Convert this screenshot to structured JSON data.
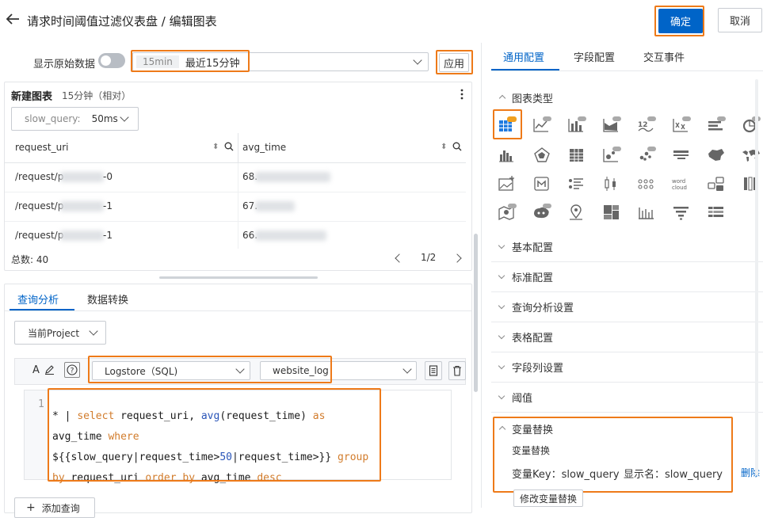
{
  "header": {
    "title": "请求时间阈值过滤仪表盘 / 编辑图表",
    "confirm_label": "确定",
    "cancel_label": "取消"
  },
  "toolbar": {
    "show_raw_label": "显示原始数据",
    "time_tag": "15min",
    "time_label": "最近15分钟",
    "apply_label": "应用"
  },
  "chart": {
    "title": "新建图表",
    "subtitle": "15分钟（相对）",
    "variable_name": "slow_query:",
    "variable_value": "50ms",
    "columns": [
      "request_uri",
      "avg_time"
    ],
    "rows": [
      {
        "uri": "/request/p",
        "uri_suffix": "-0",
        "avg": "68."
      },
      {
        "uri": "/request/p",
        "uri_suffix": "-1",
        "avg": "67."
      },
      {
        "uri": "/request/p",
        "uri_suffix": "-1",
        "avg": "66."
      }
    ],
    "total_label": "总数: 40",
    "page_label": "1/2"
  },
  "query": {
    "tabs": [
      "查询分析",
      "数据转换"
    ],
    "project_label": "当前Project",
    "logstore_type": "Logstore（SQL)",
    "logstore_name": "website_log",
    "line_number": "1",
    "code_line1_a": "* | ",
    "code_line1_b": "select",
    "code_line1_c": " request_uri, ",
    "code_line1_d": "avg",
    "code_line1_e": "(request_time) ",
    "code_line1_f": "as",
    "code_line2_a": "avg_time ",
    "code_line2_b": "where",
    "code_line3_a": "${{slow_query|request_time>",
    "code_line3_b": "50",
    "code_line3_c": "|request_time>}} ",
    "code_line3_d": "group",
    "code_line4_a": "by",
    "code_line4_b": " request_uri ",
    "code_line4_c": "order by",
    "code_line4_d": " avg_time ",
    "code_line4_e": "desc",
    "add_query_label": "添加查询"
  },
  "right_panel": {
    "tabs": [
      "通用配置",
      "字段配置",
      "交互事件"
    ],
    "chart_type_label": "图表类型",
    "sections": [
      "基本配置",
      "标准配置",
      "查询分析设置",
      "表格配置",
      "字段列设置",
      "阈值"
    ],
    "var_section_label": "变量替换",
    "var_sub_label": "变量替换",
    "var_key_label": "变量Key：slow_query",
    "var_display_label": "显示名：slow_query",
    "delete_label": "删除",
    "modify_label": "修改变量替换"
  },
  "colors": {
    "accent": "#0064c8",
    "highlight": "#ee7a19",
    "keyword": "#d27c2c",
    "pro_badge": "#f0a020"
  }
}
